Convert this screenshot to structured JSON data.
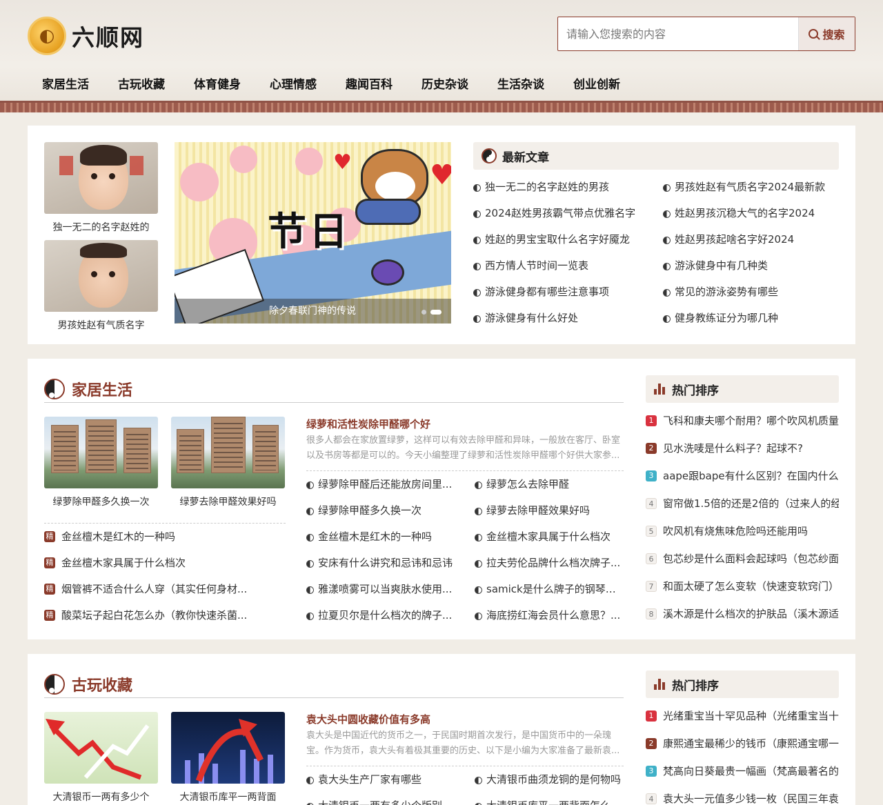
{
  "site": {
    "logo_text": "六顺网"
  },
  "search": {
    "placeholder": "请输入您搜索的内容",
    "button_label": "搜索"
  },
  "nav": [
    "家居生活",
    "古玩收藏",
    "体育健身",
    "心理情感",
    "趣闻百科",
    "历史杂谈",
    "生活杂谈",
    "创业创新"
  ],
  "top": {
    "thumbs": [
      {
        "caption": "独一无二的名字赵姓的"
      },
      {
        "caption": "男孩姓赵有气质名字"
      }
    ],
    "banner": {
      "title": "节日",
      "caption": "除夕春联门神的传说"
    },
    "latest_heading": "最新文章",
    "latest": [
      "独一无二的名字赵姓的男孩",
      "男孩姓赵有气质名字2024最新款",
      "2024赵姓男孩霸气带点优雅名字",
      "姓赵男孩沉稳大气的名字2024",
      "姓赵的男宝宝取什么名字好魇龙",
      "姓赵男孩起啥名字好2024",
      "西方情人节时间一览表",
      "游泳健身中有几种类",
      "游泳健身都有哪些注意事项",
      "常见的游泳姿势有哪些",
      "游泳健身有什么好处",
      "健身教练证分为哪几种"
    ]
  },
  "sections": [
    {
      "title": "家居生活",
      "thumbs": [
        {
          "caption": "绿萝除甲醛多久换一次"
        },
        {
          "caption": "绿萝去除甲醛效果好吗"
        }
      ],
      "jing_label": "精",
      "left_list": [
        "金丝檀木是红木的一种吗",
        "金丝檀木家具属于什么档次",
        "烟管裤不适合什么人穿（其实任何身材...",
        "酸菜坛子起白花怎么办（教你快速杀菌..."
      ],
      "feature": {
        "title": "绿萝和活性炭除甲醛哪个好",
        "desc": "很多人都会在家放置绿萝，这样可以有效去除甲醛和异味，一般放在客厅、卧室以及书房等都是可以的。今天小编整理了绿萝和活性炭除甲醛哪个好供大家参..."
      },
      "mid_list": [
        "绿萝除甲醛后还能放房间里...",
        "绿萝怎么去除甲醛",
        "绿萝除甲醛多久换一次",
        "绿萝去除甲醛效果好吗",
        "金丝檀木是红木的一种吗",
        "金丝檀木家具属于什么档次",
        "安床有什么讲究和忌讳和忌讳",
        "拉夫劳伦品牌什么档次牌子...",
        "雅漾喷雾可以当爽肤水使用...",
        "samick是什么牌子的钢琴？...",
        "拉夏贝尔是什么档次的牌子...",
        "海底捞红海会员什么意思？..."
      ],
      "rank_heading": "热门排序",
      "ranks": [
        {
          "n": "1",
          "text": "飞科和康夫哪个耐用？哪个吹风机质量"
        },
        {
          "n": "2",
          "text": "见水洗唛是什么料子？起球不?"
        },
        {
          "n": "3",
          "text": "aape跟bape有什么区别？在国内什么"
        },
        {
          "n": "4",
          "text": "窗帘做1.5倍的还是2倍的（过来人的经"
        },
        {
          "n": "5",
          "text": "吹风机有烧焦味危险吗还能用吗"
        },
        {
          "n": "6",
          "text": "包芯纱是什么面料会起球吗（包芯纱面"
        },
        {
          "n": "7",
          "text": "和面太硬了怎么变软（快速变软窍门）"
        },
        {
          "n": "8",
          "text": "溪木源是什么档次的护肤品（溪木源适"
        }
      ]
    },
    {
      "title": "古玩收藏",
      "thumbs": [
        {
          "caption": "大清银币一两有多少个"
        },
        {
          "caption": "大清银币库平一两背面"
        }
      ],
      "feature": {
        "title": "袁大头中圆收藏价值有多高",
        "desc": "袁大头是中国近代的货币之一，于民国时期首次发行，是中国货币中的一朵瑰宝。作为货币，袁大头有着极其重要的历史、以下是小编为大家准备了最新袁..."
      },
      "mid_list": [
        "袁大头生产厂家有哪些",
        "大清银币曲须龙铜的是何物吗",
        "大清银币一两有多少个版别",
        "大清银币库平一两背面怎么"
      ],
      "rank_heading": "热门排序",
      "ranks": [
        {
          "n": "1",
          "text": "光绪重宝当十罕见品种（光绪重宝当十"
        },
        {
          "n": "2",
          "text": "康熙通宝最稀少的钱币（康熙通宝哪一"
        },
        {
          "n": "3",
          "text": "梵高向日葵最贵一幅画（梵高最著名的"
        },
        {
          "n": "4",
          "text": "袁大头一元值多少钱一枚（民国三年袁"
        }
      ]
    }
  ],
  "colors": {
    "accent": "#8a3a2a",
    "rank1": "#d9323f",
    "rank2": "#8a3a2a",
    "rank3": "#3fb1c8"
  }
}
